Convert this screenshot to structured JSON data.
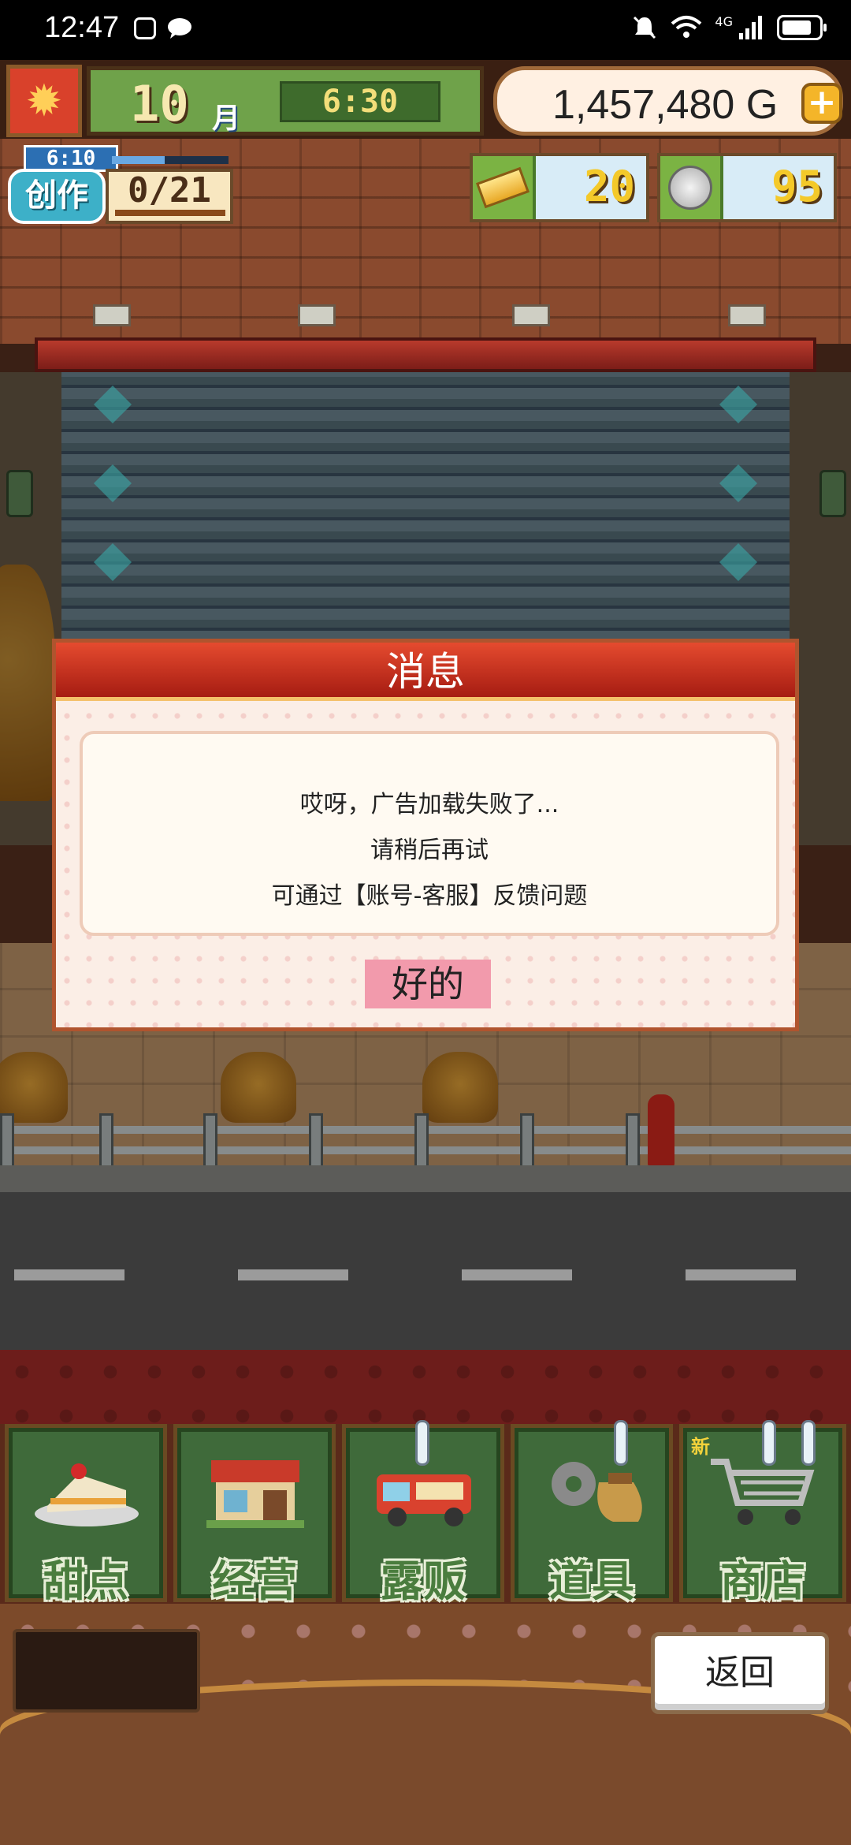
{
  "status_bar": {
    "time": "12:47",
    "network": "4G",
    "icons": [
      "notification-app-icon",
      "chat-icon",
      "mute-icon",
      "wifi-icon",
      "signal-icon",
      "battery-icon"
    ]
  },
  "hud": {
    "month_number": "10",
    "month_unit": "月",
    "clock": "6:30",
    "gold": "1,457,480 G",
    "gold_add": "+",
    "create_timer": "6:10",
    "create_label": "创作",
    "create_count": "0/21",
    "tickets": "20",
    "coins": "95"
  },
  "modal": {
    "title": "消息",
    "lines": [
      "哎呀，广告加载失败了...",
      "请稍后再试",
      "可通过【账号-客服】反馈问题"
    ],
    "ok_label": "好的"
  },
  "menu": {
    "items": [
      {
        "label": "甜点",
        "icon": "cake-icon",
        "badge": ""
      },
      {
        "label": "经营",
        "icon": "shop-icon",
        "badge": ""
      },
      {
        "label": "露贩",
        "icon": "food-truck-icon",
        "badge": ""
      },
      {
        "label": "道具",
        "icon": "gear-bag-icon",
        "badge": ""
      },
      {
        "label": "商店",
        "icon": "cart-icon",
        "badge": "新"
      }
    ]
  },
  "footer": {
    "back_label": "返回"
  },
  "colors": {
    "modal_header": "#c9321f",
    "ok_button": "#f29aac",
    "menu_tile": "#3f6a3a",
    "gold_text": "#f4c92a"
  }
}
